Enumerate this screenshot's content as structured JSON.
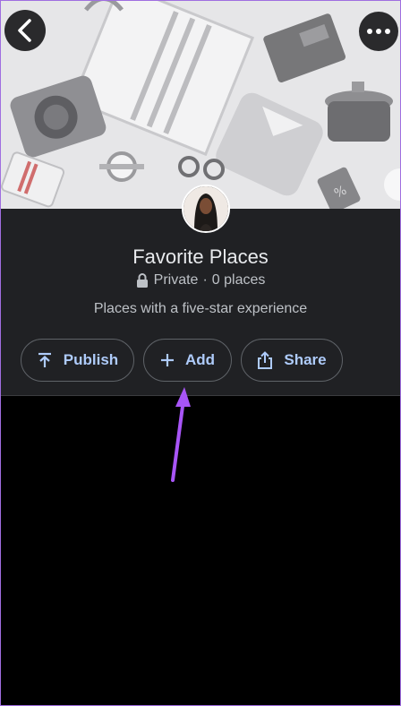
{
  "header": {
    "back_icon": "chevron-left-icon",
    "more_icon": "more-horizontal-icon"
  },
  "list": {
    "title": "Favorite Places",
    "privacy": "Private",
    "separator": "·",
    "count": "0 places",
    "description": "Places with a five-star experience"
  },
  "actions": {
    "publish_label": "Publish",
    "add_label": "Add",
    "share_label": "Share"
  },
  "colors": {
    "panel_bg": "#202124",
    "accent_text": "#aecbfa",
    "annotation_arrow": "#a855f7",
    "frame_border": "#a06ee0"
  }
}
